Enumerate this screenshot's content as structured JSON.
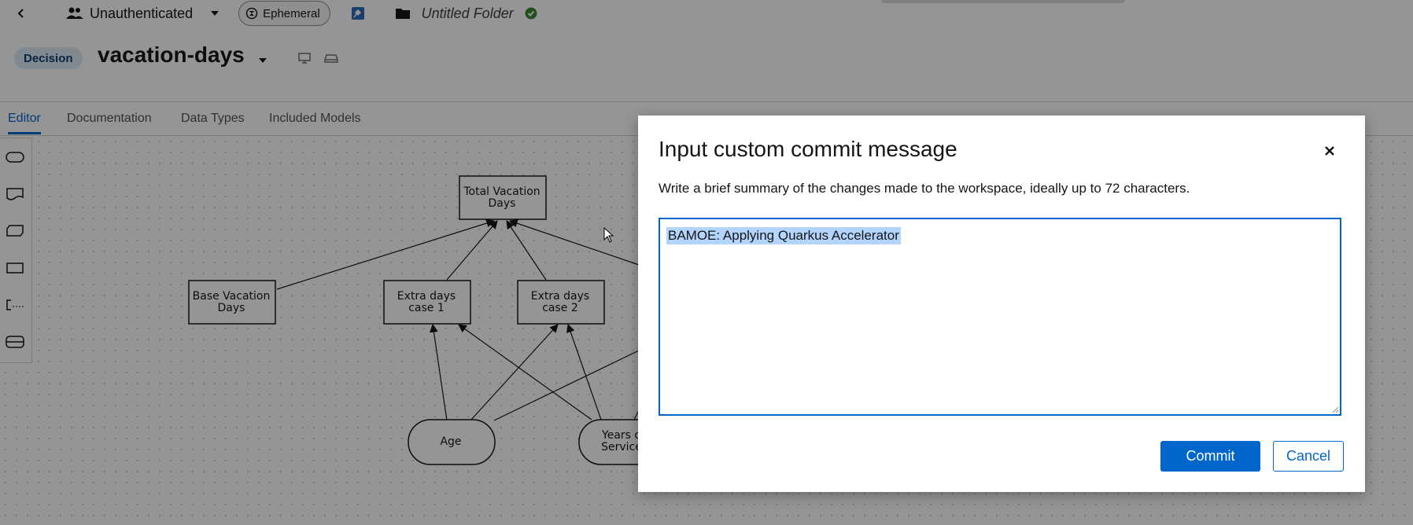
{
  "topbar": {
    "user_label": "Unauthenticated",
    "chip_label": "Ephemeral",
    "folder_label": "Untitled Folder"
  },
  "header": {
    "badge": "Decision",
    "title": "vacation-days"
  },
  "tabs": [
    {
      "label": "Editor",
      "active": true
    },
    {
      "label": "Documentation",
      "active": false
    },
    {
      "label": "Data Types",
      "active": false
    },
    {
      "label": "Included Models",
      "active": false
    }
  ],
  "diagram": {
    "nodes": {
      "total": [
        "Total Vacation",
        "Days"
      ],
      "base": [
        "Base Vacation",
        "Days"
      ],
      "extra1": [
        "Extra days",
        "case 1"
      ],
      "extra2": [
        "Extra days",
        "case 2"
      ],
      "age": "Age",
      "years": [
        "Years o",
        "Service"
      ]
    }
  },
  "modal": {
    "title": "Input custom commit message",
    "description": "Write a brief summary of the changes made to the workspace, ideally up to 72 characters.",
    "textarea_value": "BAMOE: Applying Quarkus Accelerator",
    "commit_label": "Commit",
    "cancel_label": "Cancel"
  },
  "colors": {
    "accent": "#0066cc",
    "selection": "#b3d4fc",
    "success": "#3e8635"
  }
}
